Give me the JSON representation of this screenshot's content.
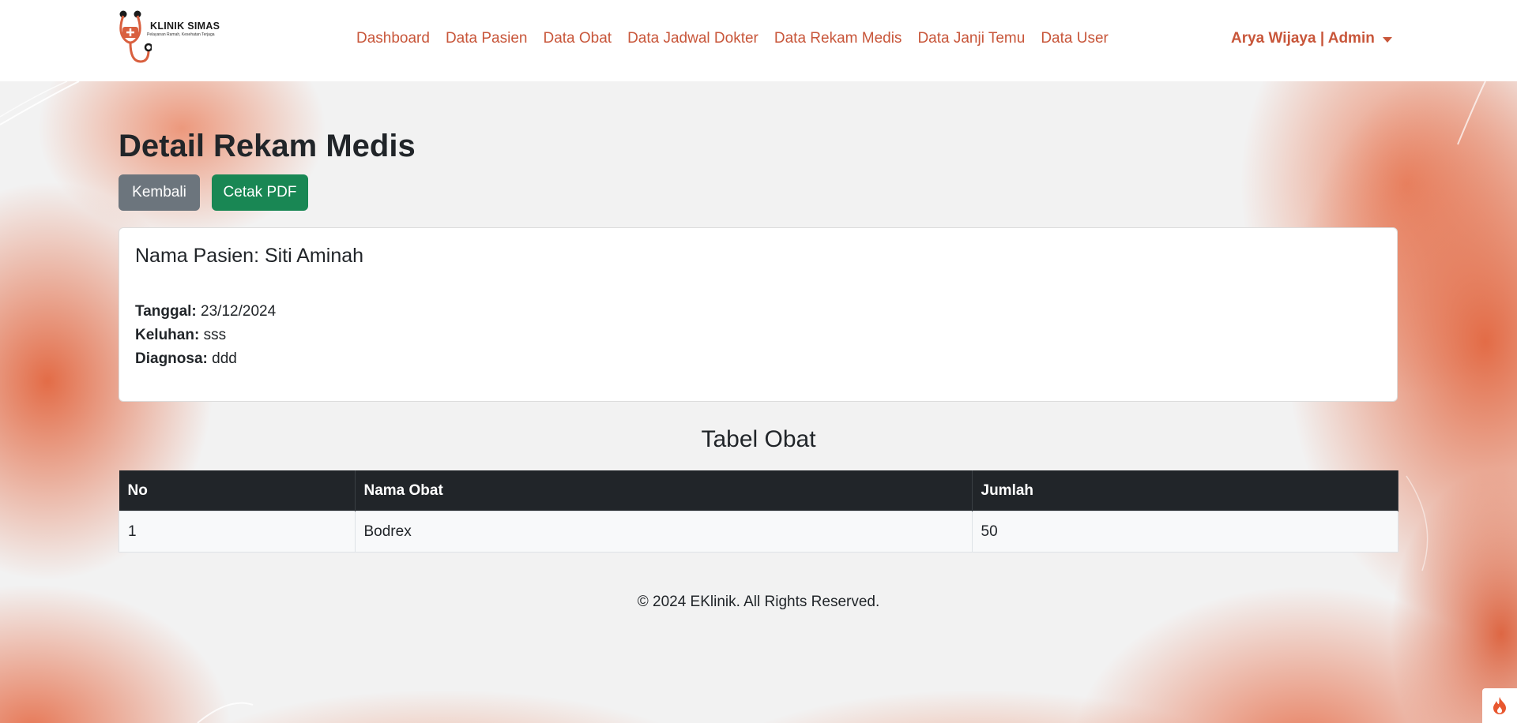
{
  "brand": {
    "name": "KLINIK SIMAS",
    "tagline": "Pelayanan Ramah, Kesehatan Terjaga"
  },
  "nav": {
    "items": [
      {
        "label": "Dashboard"
      },
      {
        "label": "Data Pasien"
      },
      {
        "label": "Data Obat"
      },
      {
        "label": "Data Jadwal Dokter"
      },
      {
        "label": "Data Rekam Medis"
      },
      {
        "label": "Data Janji Temu"
      },
      {
        "label": "Data User"
      }
    ],
    "user_label": "Arya Wijaya | Admin"
  },
  "page": {
    "title": "Detail Rekam Medis",
    "back_button": "Kembali",
    "pdf_button": "Cetak PDF"
  },
  "record": {
    "patient_heading": "Nama Pasien: Siti Aminah",
    "tanggal_label": "Tanggal:",
    "tanggal_value": "23/12/2024",
    "keluhan_label": "Keluhan:",
    "keluhan_value": "sss",
    "diagnosa_label": "Diagnosa:",
    "diagnosa_value": "ddd"
  },
  "medicine_table": {
    "title": "Tabel Obat",
    "headers": [
      "No",
      "Nama Obat",
      "Jumlah"
    ],
    "rows": [
      [
        "1",
        "Bodrex",
        "50"
      ]
    ]
  },
  "footer": {
    "text": "© 2024 EKlinik. All Rights Reserved."
  },
  "colors": {
    "accent": "#c8563a",
    "dark": "#212529",
    "secondary_button": "#6c757d",
    "success_button": "#198754"
  },
  "icons": {
    "logo": "stethoscope-logo-icon",
    "user_menu": "caret-down-icon",
    "corner_widget": "flame-icon"
  }
}
